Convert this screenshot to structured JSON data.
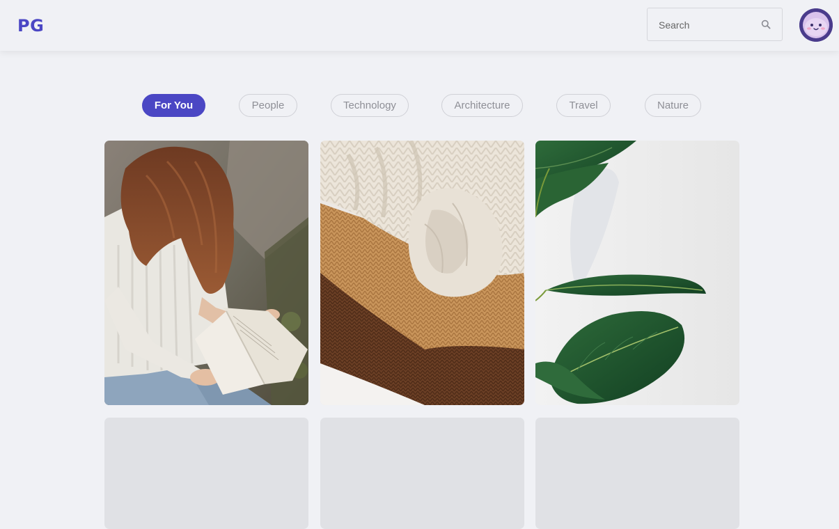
{
  "app": {
    "logo": "PG"
  },
  "search": {
    "placeholder": "Search"
  },
  "tabs": [
    {
      "label": "For You",
      "active": true
    },
    {
      "label": "People",
      "active": false
    },
    {
      "label": "Technology",
      "active": false
    },
    {
      "label": "Architecture",
      "active": false
    },
    {
      "label": "Travel",
      "active": false
    },
    {
      "label": "Nature",
      "active": false
    }
  ],
  "colors": {
    "accent": "#4b47c4",
    "background": "#f0f1f5",
    "placeholder_card": "#e0e1e5"
  },
  "gallery": {
    "cards": [
      {
        "subject": "woman-reading-book"
      },
      {
        "subject": "folded-knit-sweaters"
      },
      {
        "subject": "green-plant-leaves"
      },
      {
        "subject": "placeholder"
      },
      {
        "subject": "placeholder"
      },
      {
        "subject": "placeholder"
      }
    ]
  }
}
